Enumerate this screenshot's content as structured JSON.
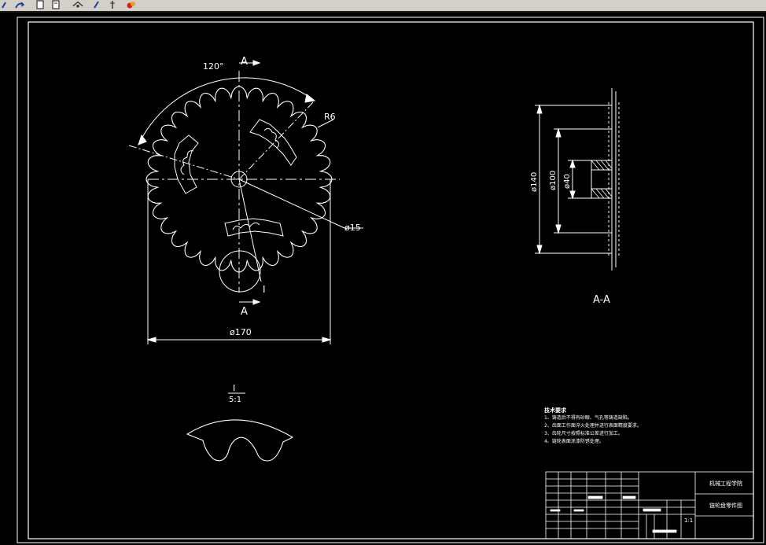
{
  "toolbar": {
    "buttons": [
      {
        "name": "undo-icon",
        "label": "Undo"
      },
      {
        "name": "redo-icon",
        "label": "Redo"
      },
      {
        "name": "copy-icon",
        "label": "Copy"
      },
      {
        "name": "paste-icon",
        "label": "Paste"
      },
      {
        "name": "properties-icon",
        "label": "Properties"
      },
      {
        "name": "match-properties-icon",
        "label": "Match properties"
      },
      {
        "name": "pointer-icon",
        "label": "Pointer"
      },
      {
        "name": "paint-icon",
        "label": "Paint"
      }
    ]
  },
  "drawing": {
    "colors": {
      "background": "#000000",
      "lines": "#ffffff",
      "toolbar": "#d4d0c8"
    },
    "front_view": {
      "angle_label": "120°",
      "section_mark_top": "A",
      "section_mark_bottom": "A",
      "radius_label": "R6",
      "hole_label": "ø15",
      "detail_marker": "I",
      "overall_diameter_label": "ø170"
    },
    "section_view": {
      "title": "A-A",
      "dim_outer": "ø140",
      "dim_mid": "ø100",
      "dim_hub": "ø40"
    },
    "detail_view": {
      "label": "I",
      "scale": "5:1"
    },
    "technical_requirements": {
      "title": "技术要求",
      "items": [
        "1、铸造后不得有砂眼、气孔等铸造缺陷。",
        "2、齿面工作面淬火处理并进行表面精度要求。",
        "3、齿轮尺寸按照标准公差进行加工。",
        "4、链轮表面涂漆防锈处理。"
      ]
    },
    "title_block": {
      "school": "机械工程学院",
      "part_name": "链轮盘零件图",
      "scale_note": "1:1"
    }
  }
}
